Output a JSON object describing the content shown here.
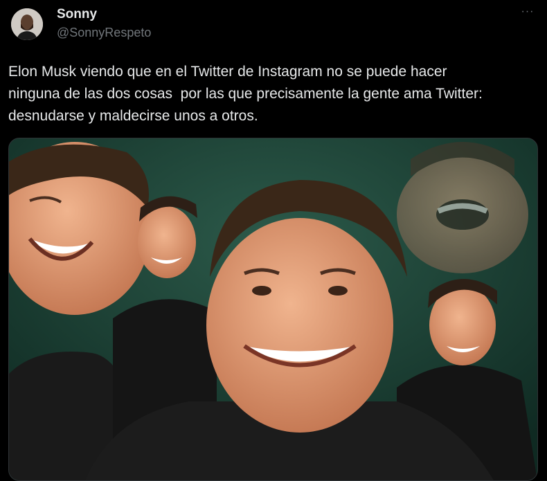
{
  "author": {
    "display_name": "Sonny",
    "handle": "@SonnyRespeto",
    "avatar_icon": "profile-avatar"
  },
  "more_options_label": "···",
  "tweet": {
    "text": "Elon Musk viendo que en el Twitter de Instagram no se puede hacer\nninguna de las dos cosas  por las que precisamente la gente ama Twitter:\ndesnudarse y maldecirse unos a otros."
  },
  "media": {
    "icon": "photo-collage-laughing-man",
    "background_color": "#183b31"
  },
  "colors": {
    "background": "#000000",
    "text_primary": "#e7e9ea",
    "text_secondary": "#71767b"
  }
}
